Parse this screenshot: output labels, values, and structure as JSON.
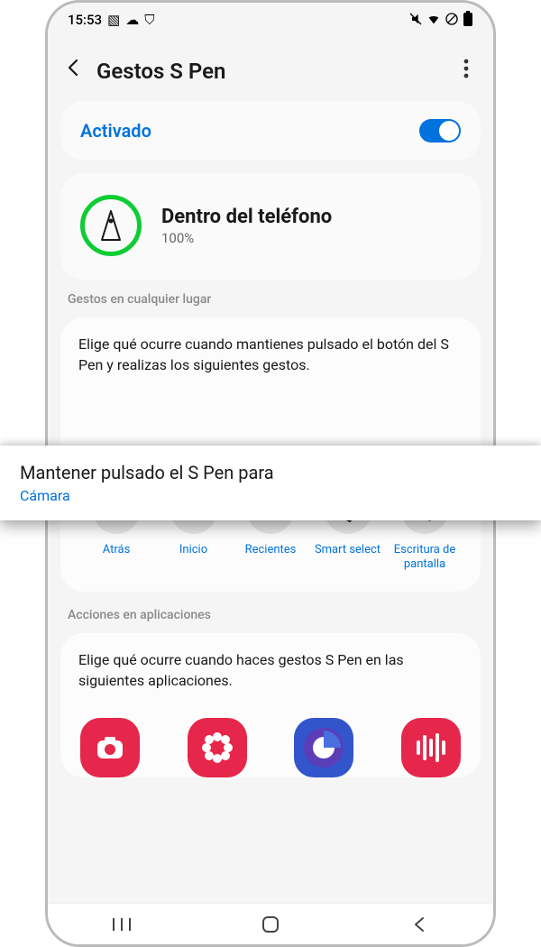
{
  "statusbar": {
    "time": "15:53",
    "left_icons": [
      "image-icon",
      "cloud-icon",
      "shield-icon"
    ],
    "right_icons": [
      "mute-icon",
      "wifi-icon",
      "no-sim-icon",
      "battery-icon"
    ]
  },
  "header": {
    "title": "Gestos S Pen"
  },
  "master_toggle": {
    "label": "Activado",
    "on": true
  },
  "pen_status": {
    "title": "Dentro del teléfono",
    "percent": "100%"
  },
  "sections": {
    "anywhere_header": "Gestos en cualquier lugar",
    "anywhere_desc": "Elige qué ocurre cuando mantienes pulsado el botón del S Pen y realizas los siguientes gestos.",
    "apps_header": "Acciones en aplicaciones",
    "apps_desc": "Elige qué ocurre cuando haces gestos S Pen en las siguientes aplicaciones."
  },
  "hold_action": {
    "title": "Mantener pulsado el S Pen para",
    "value": "Cámara"
  },
  "shortcuts": [
    {
      "id": "back",
      "label": "Atrás"
    },
    {
      "id": "home",
      "label": "Inicio"
    },
    {
      "id": "recents",
      "label": "Recientes"
    },
    {
      "id": "smart-select",
      "label": "Smart select"
    },
    {
      "id": "screen-write",
      "label": "Escritura de pantalla"
    }
  ],
  "apps": [
    {
      "id": "camera"
    },
    {
      "id": "gallery"
    },
    {
      "id": "internet"
    },
    {
      "id": "voice-recorder"
    }
  ]
}
